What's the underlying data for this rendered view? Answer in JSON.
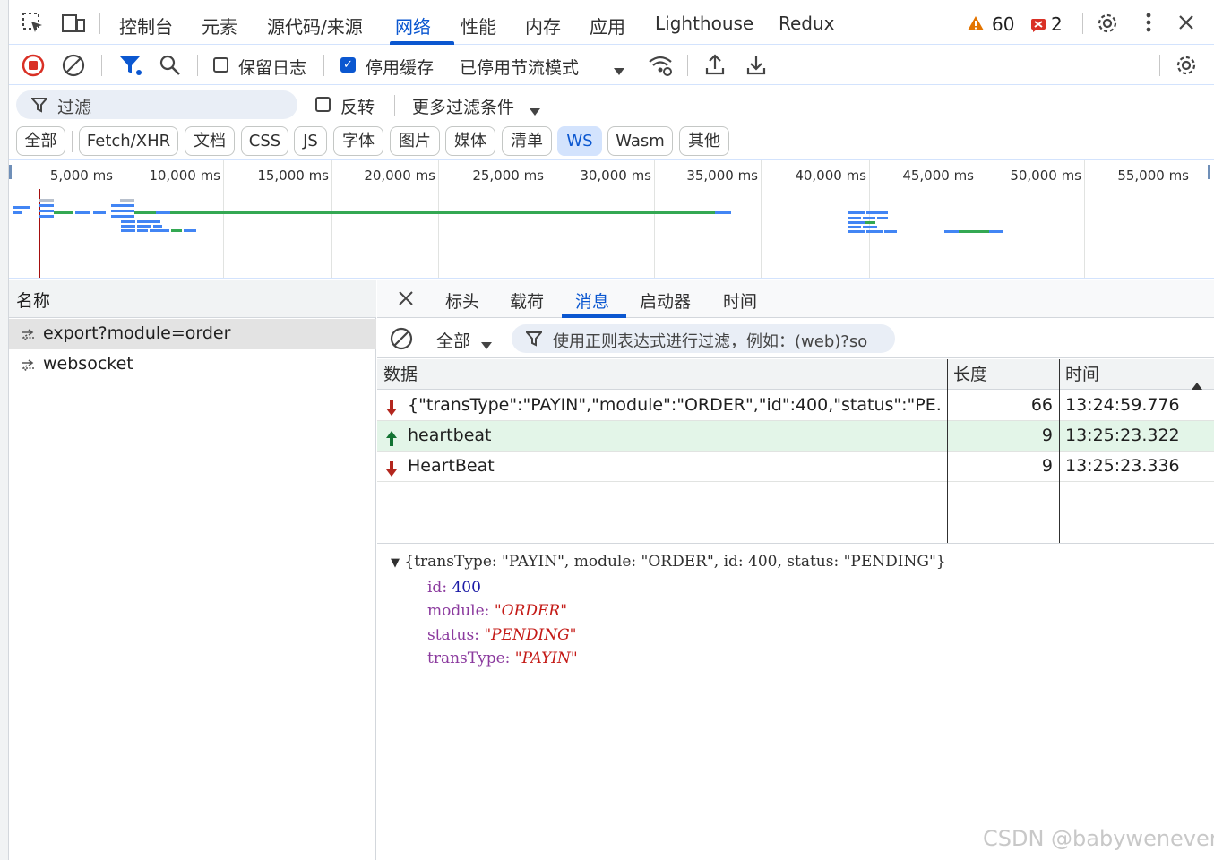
{
  "main_tabs": [
    "控制台",
    "元素",
    "源代码/来源",
    "网络",
    "性能",
    "内存",
    "应用",
    "Lighthouse",
    "Redux"
  ],
  "active_main_tab": "网络",
  "warnings_count": "60",
  "errors_count": "2",
  "toolbar": {
    "preserve_log_label": "保留日志",
    "preserve_log_checked": false,
    "disable_cache_label": "停用缓存",
    "disable_cache_checked": true,
    "throttling_label": "已停用节流模式"
  },
  "filter": {
    "placeholder": "过滤",
    "invert_label": "反转",
    "more_filters_label": "更多过滤条件"
  },
  "type_filters": [
    "全部",
    "Fetch/XHR",
    "文档",
    "CSS",
    "JS",
    "字体",
    "图片",
    "媒体",
    "清单",
    "WS",
    "Wasm",
    "其他"
  ],
  "active_type_filter": "WS",
  "overview_ticks": [
    "5,000 ms",
    "10,000 ms",
    "15,000 ms",
    "20,000 ms",
    "25,000 ms",
    "30,000 ms",
    "35,000 ms",
    "40,000 ms",
    "45,000 ms",
    "50,000 ms",
    "55,000 ms"
  ],
  "requests": {
    "header": "名称",
    "items": [
      {
        "name": "export?module=order",
        "selected": true
      },
      {
        "name": "websocket",
        "selected": false
      }
    ]
  },
  "detail_tabs": [
    "标头",
    "载荷",
    "消息",
    "启动器",
    "时间"
  ],
  "active_detail_tab": "消息",
  "messages": {
    "filter_all_label": "全部",
    "regex_placeholder": "使用正则表达式进行过滤，例如：(web)?so",
    "columns": [
      "数据",
      "长度",
      "时间"
    ],
    "rows": [
      {
        "direction": "received",
        "data": "{\"transType\":\"PAYIN\",\"module\":\"ORDER\",\"id\":400,\"status\":\"PE...",
        "length": "66",
        "time": "13:24:59.776"
      },
      {
        "direction": "sent",
        "data": "heartbeat",
        "length": "9",
        "time": "13:25:23.322"
      },
      {
        "direction": "received",
        "data": "HeartBeat",
        "length": "9",
        "time": "13:25:23.336"
      }
    ]
  },
  "detail": {
    "summary": "{transType: \"PAYIN\", module: \"ORDER\", id: 400, status: \"PENDING\"}",
    "props": [
      {
        "key": "id:",
        "value": "400",
        "type": "number"
      },
      {
        "key": "module:",
        "value": "\"ORDER\"",
        "type": "string"
      },
      {
        "key": "status:",
        "value": "\"PENDING\"",
        "type": "string"
      },
      {
        "key": "transType:",
        "value": "\"PAYIN\"",
        "type": "string"
      }
    ]
  },
  "watermark": "CSDN @babywenever",
  "colors": {
    "accent": "#0b57d0",
    "record": "#d93025",
    "received_arrow": "#b3261e",
    "sent_arrow": "#137333",
    "sent_row_bg": "#e3f5e8"
  }
}
